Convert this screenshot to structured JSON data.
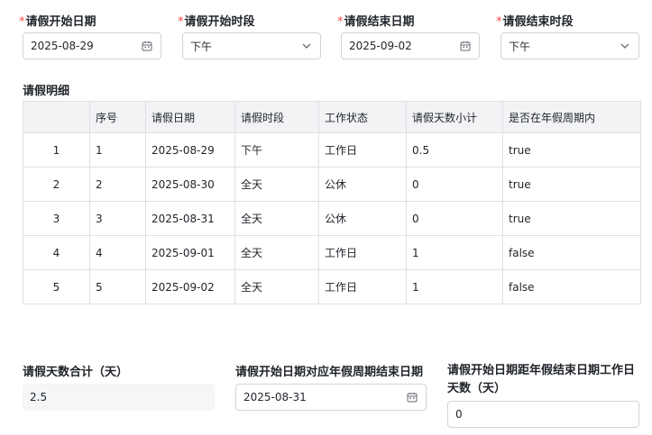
{
  "form": {
    "start_date": {
      "label": "请假开始日期",
      "required_mark": "*",
      "value": "2025-08-29",
      "icon": "calendar-icon"
    },
    "start_period": {
      "label": "请假开始时段",
      "required_mark": "*",
      "value": "下午",
      "icon": "chevron-down-icon"
    },
    "end_date": {
      "label": "请假结束日期",
      "required_mark": "*",
      "value": "2025-09-02",
      "icon": "calendar-icon"
    },
    "end_period": {
      "label": "请假结束时段",
      "required_mark": "*",
      "value": "下午",
      "icon": "chevron-down-icon"
    }
  },
  "details": {
    "title": "请假明细",
    "columns": [
      "",
      "序号",
      "请假日期",
      "请假时段",
      "工作状态",
      "请假天数小计",
      "是否在年假周期内"
    ],
    "rows": [
      [
        "1",
        "1",
        "2025-08-29",
        "下午",
        "工作日",
        "0.5",
        "true"
      ],
      [
        "2",
        "2",
        "2025-08-30",
        "全天",
        "公休",
        "0",
        "true"
      ],
      [
        "3",
        "3",
        "2025-08-31",
        "全天",
        "公休",
        "0",
        "true"
      ],
      [
        "4",
        "4",
        "2025-09-01",
        "全天",
        "工作日",
        "1",
        "false"
      ],
      [
        "5",
        "5",
        "2025-09-02",
        "全天",
        "工作日",
        "1",
        "false"
      ]
    ]
  },
  "summary": {
    "total_days": {
      "label": "请假天数合计（天）",
      "value": "2.5"
    },
    "cycle_end": {
      "label": "请假开始日期对应年假周期结束日期",
      "value": "2025-08-31",
      "icon": "calendar-icon"
    },
    "workdays_to_end": {
      "label_line1": "请假开始日期距年假结束日期工作日",
      "label_line2": "天数（天）",
      "value": "0"
    }
  }
}
